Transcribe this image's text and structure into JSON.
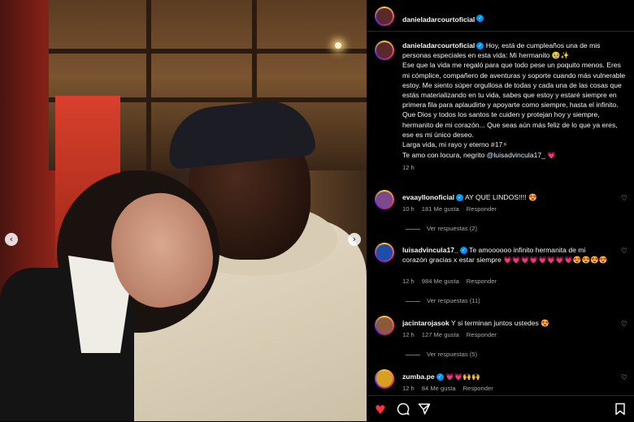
{
  "post": {
    "author": "danieladarcourtoficial",
    "caption_lines": [
      "Hoy, está de cumpleaños una de mis personas especiales en esta vida: Mi hermanito 🥹✨",
      "Ese que la vida me regaló para que todo pese un poquito menos. Eres mi cómplice, compañero de aventuras y soporte cuando más vulnerable estoy. Me siento súper orgullosa de todas y cada una de las cosas que estás materializando en tu vida, sabes que estoy y estaré siempre en primera fila para aplaudirte y apoyarte como siempre, hasta el infinito.",
      "Que Dios y todos los santos te cuiden y protejan hoy y siempre, hermanito de mi corazón... Que seas aún más feliz de lo que ya eres, ese es mi único deseo.",
      "Larga vida, mi rayo y eterno",
      "Te amo con locura, negrito"
    ],
    "hashtag": "#17",
    "hashtag_emoji": "⚡",
    "mention": "@luisadvincula17_",
    "mention_emoji": "💗",
    "time": "12 h"
  },
  "comments": [
    {
      "user": "evaayllonoficial",
      "verified": true,
      "text": "AY QUE LINDOS!!!! 😍",
      "time": "10 h",
      "likes": "181 Me gusta",
      "reply": "Responder",
      "view_replies": "Ver respuestas (2)",
      "avatar_color": "#7a4a8a"
    },
    {
      "user": "luisadvincula17_",
      "verified": true,
      "text": "Te amoooooo infinito hermanita de mi corazón gracias x estar siempre 💗💗💗💗💗💗💗💗😍😍😍😍",
      "time": "12 h",
      "likes": "984 Me gusta",
      "reply": "Responder",
      "view_replies": "Ver respuestas (11)",
      "avatar_color": "#1f4ea8"
    },
    {
      "user": "jacintarojasok",
      "verified": false,
      "text": "Y si terminan juntos ustedes 😍",
      "time": "12 h",
      "likes": "127 Me gusta",
      "reply": "Responder",
      "view_replies": "Ver respuestas (5)",
      "avatar_color": "#8a5a3a"
    },
    {
      "user": "zumba.pe",
      "verified": true,
      "text": "💗💗🙌🙌",
      "time": "12 h",
      "likes": "84 Me gusta",
      "reply": "Responder",
      "view_replies": "",
      "avatar_color": "#d8a020"
    }
  ],
  "icons": {
    "like": "heart-icon",
    "comment": "comment-icon",
    "share": "share-icon",
    "save": "bookmark-icon",
    "prev": "chevron-left-icon",
    "next": "chevron-right-icon"
  },
  "colors": {
    "like": "#ff3040",
    "verified": "#0095f6"
  }
}
